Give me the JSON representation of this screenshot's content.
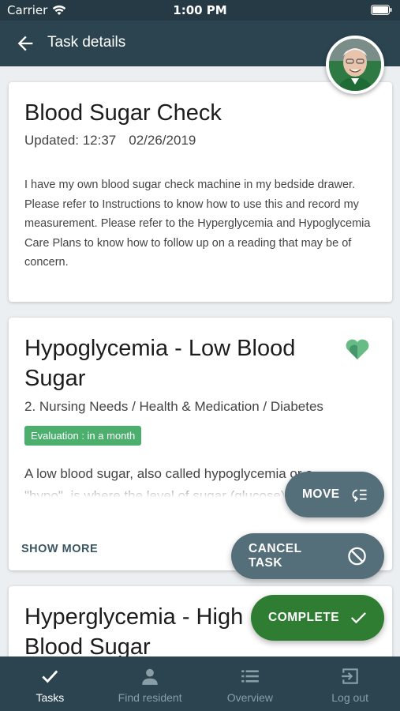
{
  "status_bar": {
    "carrier": "Carrier",
    "time": "1:00 PM"
  },
  "app_bar": {
    "title": "Task details"
  },
  "task_card": {
    "title": "Blood Sugar Check",
    "updated_label": "Updated: 12:37",
    "updated_date": "02/26/2019",
    "description": "I have my own blood sugar check machine in my bedside drawer. Please refer to Instructions to know how to use this and record my measurement. Please refer to the Hyperglycemia and Hypoglycemia Care Plans to know how to follow up on a reading that may be of concern."
  },
  "care_plan_card": {
    "title": "Hypoglycemia - Low Blood Sugar",
    "path": "2. Nursing Needs / Health & Medication / Diabetes",
    "badge": "Evaluation : in a month",
    "preview_line1": "A low blood sugar, also called hypoglycemia or a",
    "preview_line2": "\"hypo\", is where the level of sugar (glucose) in your",
    "show_more": "SHOW MORE",
    "icon": "heart-icon"
  },
  "care_plan_card_2": {
    "title": "Hyperglycemia - High Blood Sugar"
  },
  "fabs": {
    "move": "MOVE",
    "cancel": "CANCEL TASK",
    "complete": "COMPLETE"
  },
  "nav": [
    {
      "label": "Tasks",
      "icon": "check-icon"
    },
    {
      "label": "Find resident",
      "icon": "person-icon"
    },
    {
      "label": "Overview",
      "icon": "list-icon"
    },
    {
      "label": "Log out",
      "icon": "logout-icon"
    }
  ],
  "colors": {
    "header": "#2b4450",
    "badge": "#4caf6e",
    "complete": "#2e7d32",
    "secondary_fab": "#546e7a"
  }
}
